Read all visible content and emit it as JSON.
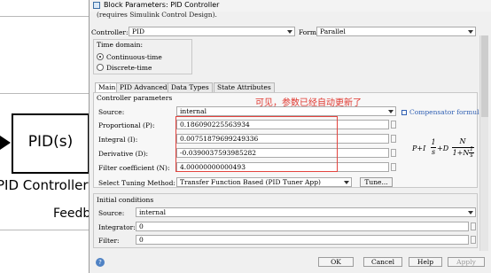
{
  "dialog": {
    "title": "Block Parameters: PID Controller",
    "desc": "(requires Simulink Control Design).",
    "controller_label": "Controller:",
    "controller_value": "PID",
    "form_label": "Form:",
    "form_value": "Parallel",
    "time_domain_label": "Time domain:",
    "time_options": [
      "Continuous-time",
      "Discrete-time"
    ],
    "tabs": [
      "Main",
      "PID Advanced",
      "Data Types",
      "State Attributes"
    ],
    "params_title": "Controller parameters",
    "source_label": "Source:",
    "source_value": "internal",
    "compensator_link": "Compensator formula",
    "params": [
      {
        "label": "Proportional (P):",
        "value": "0.186090225563934"
      },
      {
        "label": "Integral (I):",
        "value": "0.00751879699249336"
      },
      {
        "label": "Derivative (D):",
        "value": "-0.0390037593985282"
      },
      {
        "label": "Filter coefficient (N):",
        "value": "4.00000000000493"
      }
    ],
    "tuning_label": "Select Tuning Method:",
    "tuning_value": "Transfer Function Based (PID Tuner App)",
    "tune_button": "Tune...",
    "note": "可见，参数已经自动更新了",
    "initial_title": "Initial conditions",
    "init_source_label": "Source:",
    "init_source_value": "internal",
    "integrator_label": "Integrator:",
    "integrator_value": "0",
    "filter_label": "Filter:",
    "filter_value": "0",
    "buttons": {
      "ok": "OK",
      "cancel": "Cancel",
      "help": "Help",
      "apply": "Apply"
    },
    "help_icon_glyph": "?"
  },
  "canvas": {
    "block_label": "PID(s)",
    "block_caption": "PID Controller",
    "feedback_caption": "Feedb"
  },
  "formula": {
    "lead": "P+I",
    "mid": "+D",
    "one": "1",
    "s": "s",
    "n": "N",
    "den": "1+N"
  },
  "colors": {
    "annotation": "#e3443f",
    "link": "#2f5fb3",
    "icon": "#4f82c4"
  }
}
